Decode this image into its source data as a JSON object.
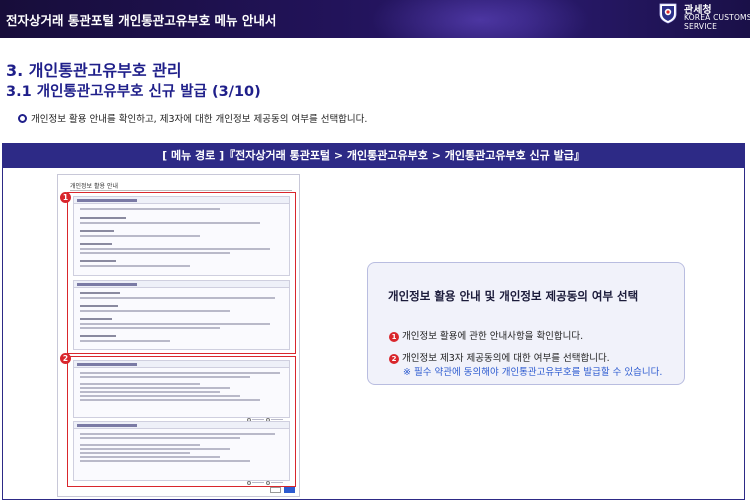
{
  "header": {
    "title": "전자상거래 통관포털 개인통관고유부호 메뉴 안내서",
    "brand_ko": "관세청",
    "brand_en_line1": "KOREA CUSTOMS",
    "brand_en_line2": "SERVICE"
  },
  "section": {
    "heading": "3. 개인통관고유부호 관리",
    "subheading": "3.1 개인통관고유부호 신규 발급 (3/10)",
    "description": "개인정보 활용 안내를 확인하고, 제3자에 대한 개인정보 제공동의 여부를 선택합니다."
  },
  "menu_path": "[ 메뉴 경로 ]『전자상거래 통관포털 > 개인통관고유부호 > 개인통관고유부호 신규 발급』",
  "screenshot": {
    "page_title": "개인정보 활용 안내",
    "markers": [
      "1",
      "2"
    ]
  },
  "callout": {
    "title": "개인정보 활용 안내 및 개인정보 제공동의 여부 선택",
    "item1_num": "1",
    "item1": "개인정보 활용에 관한 안내사항을 확인합니다.",
    "item2_num": "2",
    "item2": "개인정보 제3자 제공동의에 대한 여부를 선택합니다.",
    "note": "※ 필수 약관에 동의해야 개인통관고유부호를 발급할 수 있습니다."
  },
  "colors": {
    "heading": "#1f1f8a",
    "path_bar": "#2d2a86",
    "marker": "#d9262c",
    "note": "#2d5bd0"
  }
}
